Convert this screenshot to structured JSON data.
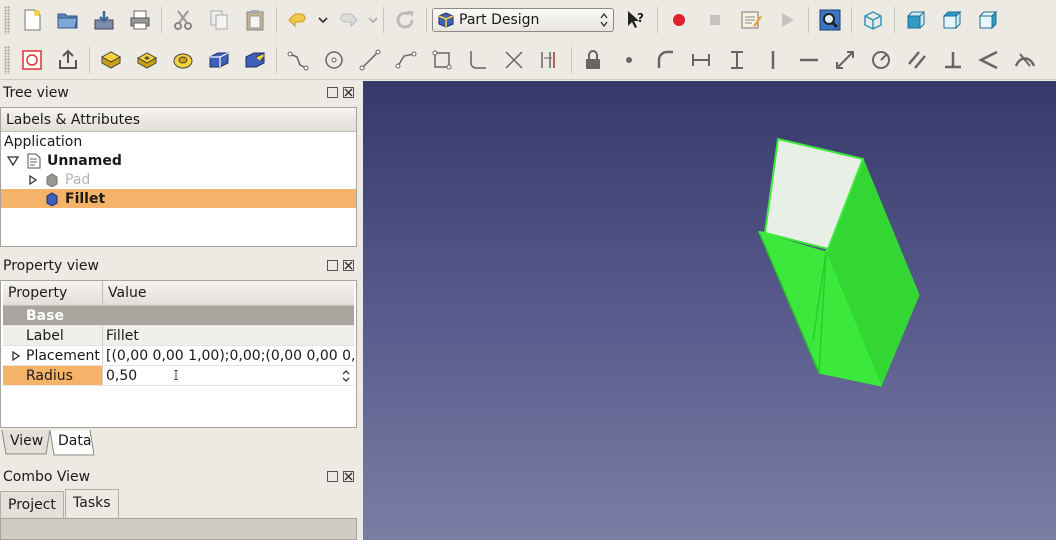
{
  "toolbar": {
    "workbench": "Part Design"
  },
  "tree_view": {
    "title": "Tree view",
    "header": "Labels & Attributes",
    "application_label": "Application",
    "document": "Unnamed",
    "items": [
      {
        "label": "Pad"
      },
      {
        "label": "Fillet"
      }
    ]
  },
  "property_view": {
    "title": "Property view",
    "col_property": "Property",
    "col_value": "Value",
    "group": "Base",
    "rows": [
      {
        "name": "Label",
        "value": "Fillet"
      },
      {
        "name": "Placement",
        "value": "[(0,00 0,00 1,00);0,00;(0,00 0,00 0,0…"
      },
      {
        "name": "Radius",
        "value": "0,50"
      }
    ],
    "tabs": [
      "View",
      "Data"
    ]
  },
  "combo_view": {
    "title": "Combo View",
    "tabs": [
      "Project",
      "Tasks"
    ]
  },
  "colors": {
    "selection": "#f5b36a",
    "solid_green": "#3de83d",
    "viewport_top": "#36386b",
    "viewport_bottom": "#7b7ea3"
  }
}
